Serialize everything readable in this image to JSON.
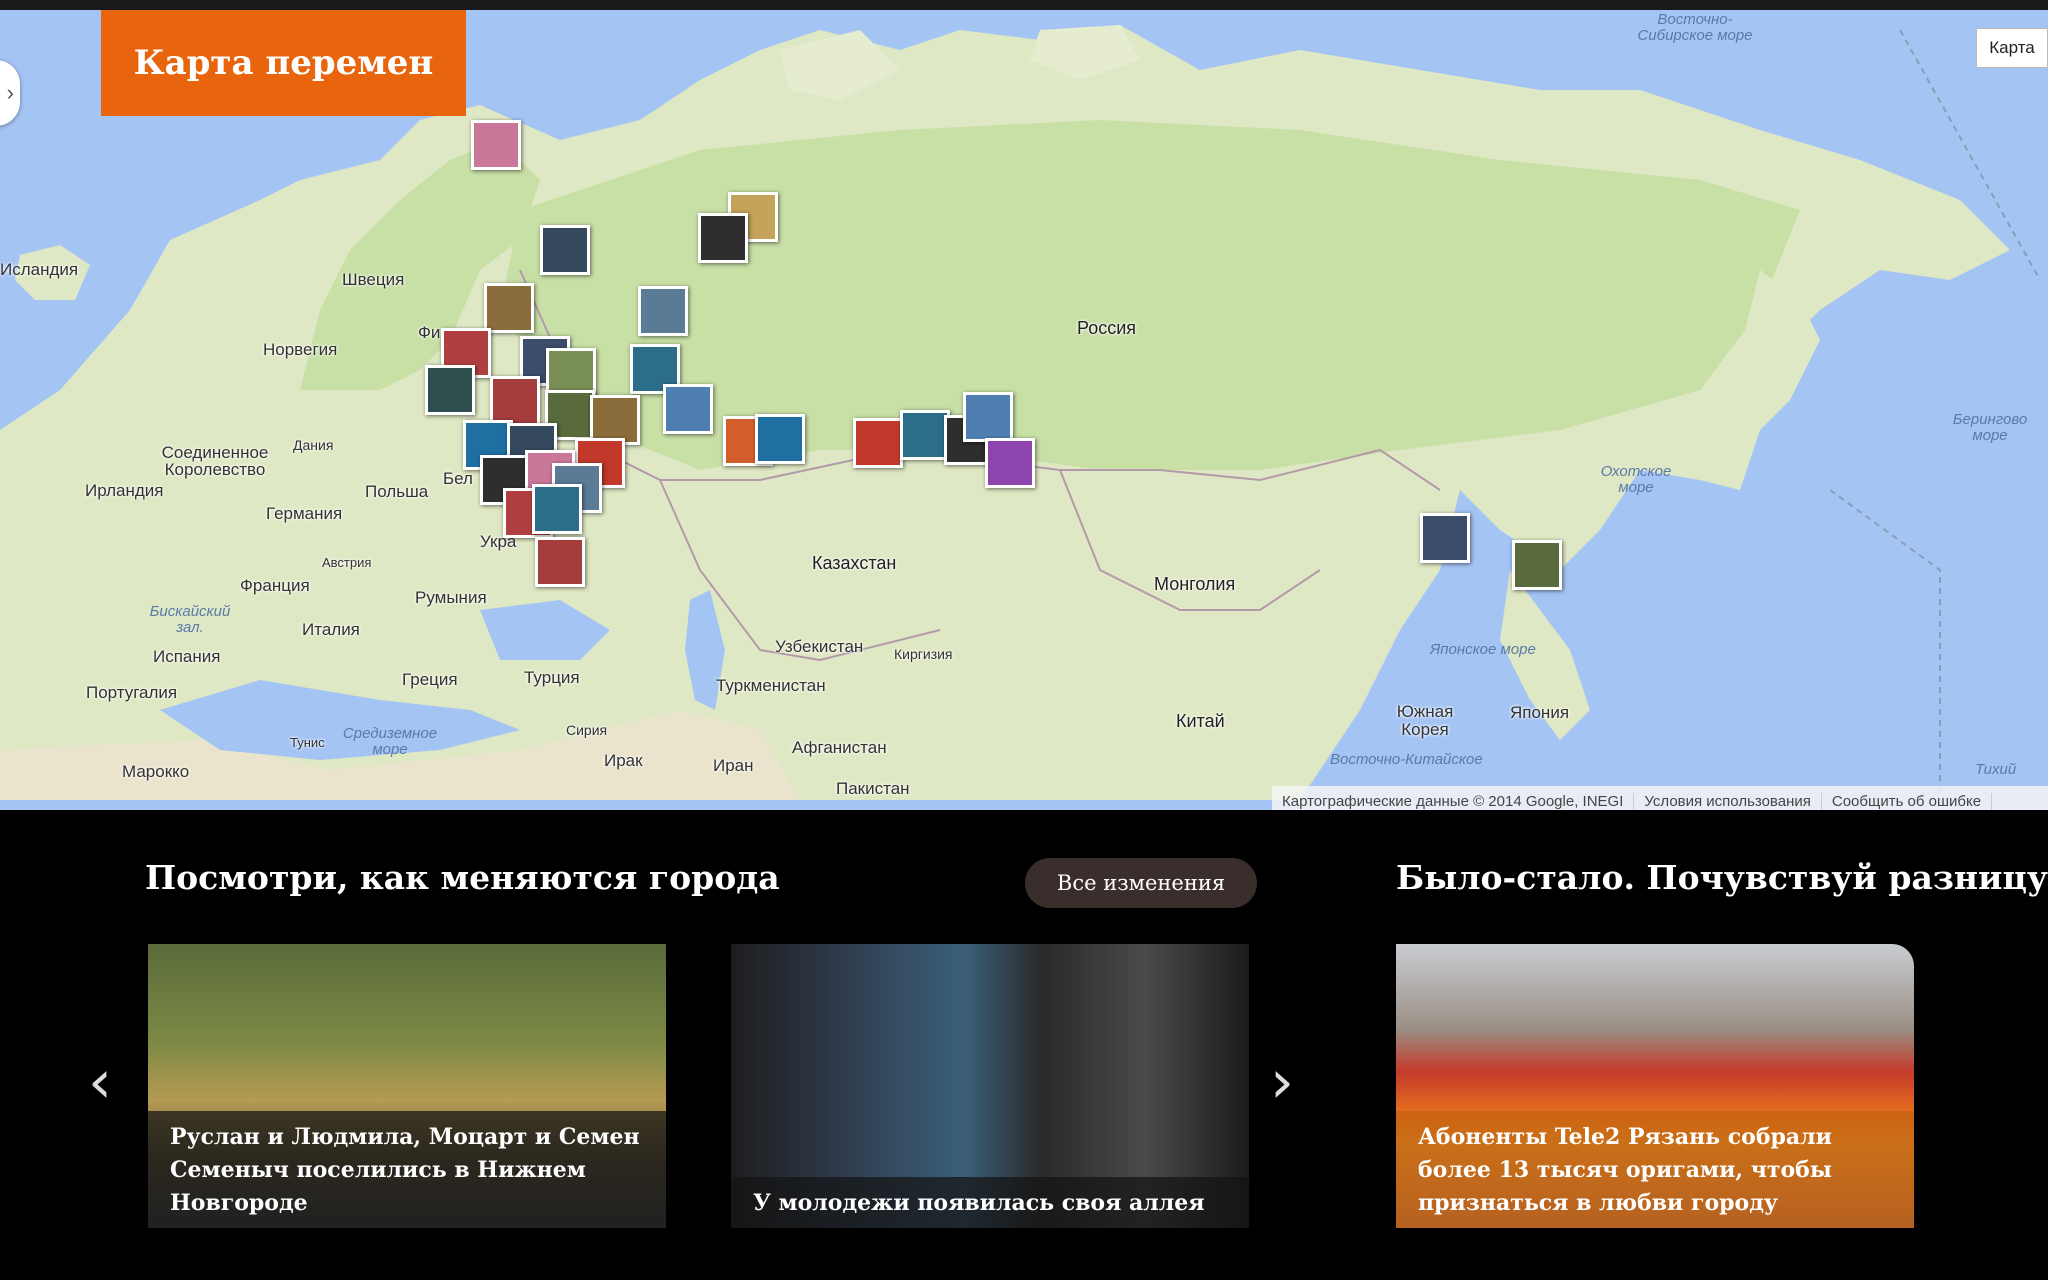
{
  "header": {
    "title": "Карта перемен"
  },
  "map": {
    "map_type_label": "Карта",
    "toggle_icon": "chevron-right-icon",
    "labels": {
      "iceland": "Исландия",
      "sweden": "Швеция",
      "norway": "Норвегия",
      "finland": "Фи",
      "russia": "Россия",
      "uk": "Соединенное Королевство",
      "ireland": "Ирландия",
      "denmark": "Дания",
      "poland": "Польша",
      "germany": "Германия",
      "belarus": "Бел",
      "austria": "Австрия",
      "ukraine": "Укра",
      "france": "Франция",
      "romania": "Румыния",
      "italy": "Италия",
      "spain": "Испания",
      "portugal": "Португалия",
      "greece": "Греция",
      "turkey": "Турция",
      "kazakhstan": "Казахстан",
      "mongolia": "Монголия",
      "uzbekistan": "Узбекистан",
      "kyrgyzstan": "Киргизия",
      "turkmenistan": "Туркменистан",
      "syria": "Сирия",
      "iraq": "Ирак",
      "iran": "Иран",
      "afghanistan": "Афганистан",
      "pakistan": "Пакистан",
      "china": "Китай",
      "south_korea": "Южная Корея",
      "japan": "Япония",
      "morocco": "Марокко",
      "tunisia": "Тунис"
    },
    "seas": {
      "east_siberian": "Восточно-Сибирское море",
      "bering": "Берингово море",
      "okhotsk": "Охотское море",
      "japan_sea": "Японское море",
      "east_china": "Восточно-Китайское",
      "biscay": "Бискайский зал.",
      "mediterranean": "Средиземное море",
      "pacific": "Тихий"
    },
    "attribution": {
      "data": "Картографические данные © 2014 Google, INEGI",
      "terms": "Условия использования",
      "report": "Сообщить об ошибке"
    },
    "photo_colors": [
      "#c9789a",
      "#34495e",
      "#8a6d3b",
      "#3b4d6b",
      "#b04040",
      "#5a7a96",
      "#2e2e2e",
      "#7a8f55",
      "#d25e2c",
      "#4f7fb0",
      "#a63d3d",
      "#2c6e8a",
      "#c4a35a",
      "#596a3d",
      "#8e44ad",
      "#2f4f4f",
      "#c0392b",
      "#1f6fa3"
    ]
  },
  "changes": {
    "heading": "Посмотри, как меняются города",
    "all_button": "Все изменения",
    "prev_icon": "chevron-left-icon",
    "next_icon": "chevron-right-icon",
    "cards": [
      {
        "caption": "Руслан и Людмила, Моцарт и Семен Семеныч поселились в Нижнем Новгороде"
      },
      {
        "caption": "У молодежи появилась своя аллея"
      }
    ]
  },
  "before_after": {
    "heading": "Было-стало. Почувствуй разницу.",
    "card": {
      "caption": "Абоненты Tele2 Рязань собрали более 13 тысяч оригами, чтобы признаться в любви городу"
    }
  }
}
